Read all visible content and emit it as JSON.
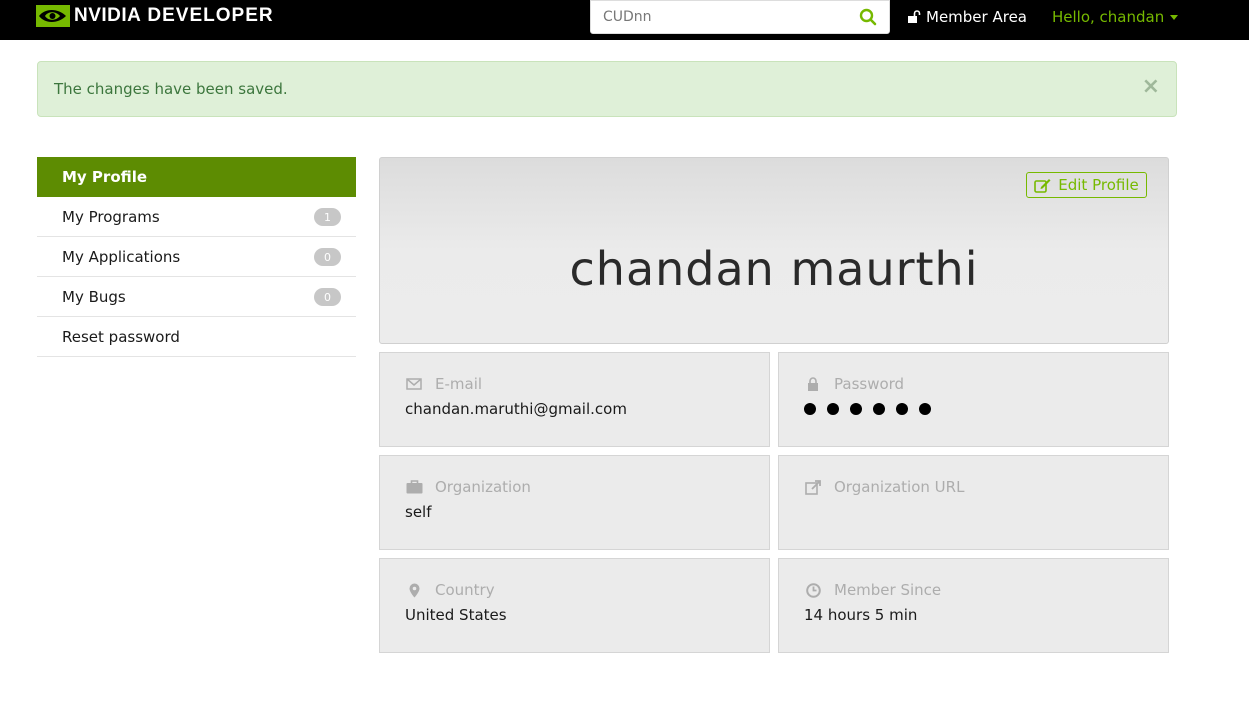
{
  "header": {
    "logo_brand": "NVIDIA",
    "logo_product": "DEVELOPER",
    "search_value": "CUDnn",
    "member_area_label": "Member Area",
    "hello_label": "Hello, chandan",
    "accent_color": "#76b900"
  },
  "alert": {
    "message": "The changes have been saved.",
    "close_label": "×"
  },
  "sidebar": {
    "items": [
      {
        "label": "My Profile",
        "active": true
      },
      {
        "label": "My Programs",
        "count": "1"
      },
      {
        "label": "My Applications",
        "count": "0"
      },
      {
        "label": "My Bugs",
        "count": "0"
      },
      {
        "label": "Reset password"
      }
    ]
  },
  "profile": {
    "edit_label": "Edit Profile",
    "name": "chandan maurthi"
  },
  "fields": {
    "email": {
      "label": "E-mail",
      "value": "chandan.maruthi@gmail.com",
      "icon": "envelope-icon"
    },
    "password": {
      "label": "Password",
      "masked_length": 6,
      "icon": "lock-icon"
    },
    "organization": {
      "label": "Organization",
      "value": "self",
      "icon": "briefcase-icon"
    },
    "organization_url": {
      "label": "Organization URL",
      "value": "",
      "icon": "external-link-icon"
    },
    "country": {
      "label": "Country",
      "value": "United States",
      "icon": "map-marker-icon"
    },
    "member_since": {
      "label": "Member Since",
      "value": "14 hours 5 min",
      "icon": "clock-icon"
    }
  }
}
